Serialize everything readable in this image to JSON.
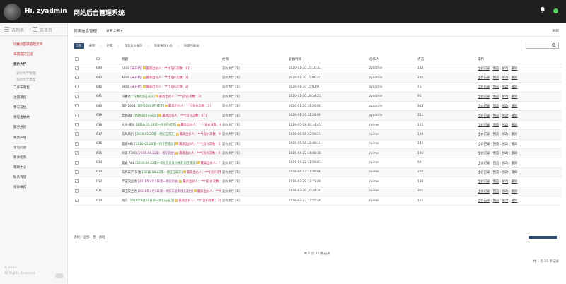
{
  "header": {
    "greeting": "Hi, zyadmin",
    "system_title": "网站后台管理系统"
  },
  "sidebar": {
    "tabs": [
      "选列表",
      "选单页"
    ],
    "items": [
      {
        "label": "切换到首级管理菜单",
        "cls": "hi"
      },
      {
        "label": "车辆成交记录",
        "cls": "hi"
      },
      {
        "label": "竞价大厅",
        "cls": "active"
      },
      {
        "label": "竞价大厅管理",
        "cls": "sub"
      },
      {
        "label": "竞价大厅类型",
        "cls": "sub"
      },
      {
        "label": "二手车寄售",
        "cls": ""
      },
      {
        "label": "注册流程",
        "cls": ""
      },
      {
        "label": "参与竞拍",
        "cls": ""
      },
      {
        "label": "保证金缴纳",
        "cls": ""
      },
      {
        "label": "服务条款",
        "cls": ""
      },
      {
        "label": "免责声明",
        "cls": ""
      },
      {
        "label": "常见问题",
        "cls": ""
      },
      {
        "label": "新手指南",
        "cls": ""
      },
      {
        "label": "帮助中心",
        "cls": ""
      },
      {
        "label": "联系我们",
        "cls": ""
      },
      {
        "label": "投诉举报",
        "cls": ""
      }
    ],
    "footer": [
      "© 2014",
      "All Rights Reserved."
    ]
  },
  "main": {
    "breadcrumb": "列表信息管理",
    "view_label": "查看全部",
    "refresh_label": "刷新",
    "filters": [
      "全部",
      "未审",
      "已审",
      "首页竞价推荐",
      "预发布的文档",
      "内容回收站"
    ],
    "columns": [
      "ID",
      "标题",
      "栏目",
      "竞拍时间",
      "发布人",
      "点击",
      "操作"
    ],
    "rows": [
      {
        "id": "644",
        "title": "5008",
        "status": "[未开始]",
        "done": false,
        "extra": "[竞价次数：11]",
        "cat": "竞价大厅 [1]",
        "date": "2020-01-30 15:10:31",
        "user": "zyadmin",
        "clicks": "132"
      },
      {
        "id": "643",
        "title": "4008",
        "status": "[未开始]",
        "done": false,
        "extra": "[竞价次数：2]",
        "cat": "竞价大厅 [1]",
        "date": "2020-01-30 15:09:47",
        "user": "zyadmin",
        "clicks": "295"
      },
      {
        "id": "642",
        "title": "3008",
        "status": "[未开始]",
        "done": false,
        "extra": "[竞价次数：2]",
        "cat": "竞价大厅 [1]",
        "date": "2020-01-30 15:03:07",
        "user": "zyadmin",
        "clicks": "71"
      },
      {
        "id": "641",
        "title": "马嘉达",
        "status": "[马嘉达][已成交]",
        "done": true,
        "extra": "[竞价次数：3]",
        "cat": "竞价大厅 [1]",
        "date": "2020-01-30 18:54:21",
        "user": "zyadmin",
        "clicks": "91"
      },
      {
        "id": "640",
        "title": "保时2008",
        "status": "[保时2008][已成交]",
        "done": true,
        "extra": "[竞价次数：3]",
        "cat": "竞价大厅 [1]",
        "date": "2020-01-30 21:26:00",
        "user": "zyadmin",
        "clicks": "313"
      },
      {
        "id": "639",
        "title": "奔驰s级",
        "status": "[奔驰s级][已成交]",
        "done": true,
        "extra": "[竞价次数：67]",
        "cat": "竞价大厅 [1]",
        "date": "2020-01-30 21:28:00",
        "user": "zyadmin",
        "clicks": "311"
      },
      {
        "id": "638",
        "title": "大众-捷达",
        "status": "[2016.05.20第一场][已成交]",
        "done": true,
        "extra": "[竞价次数：6]",
        "cat": "竞价大厅 [1]",
        "date": "2016-05-18 00:14:45",
        "user": "ruimei",
        "clicks": "165"
      },
      {
        "id": "637",
        "title": "东风风行",
        "status": "[2016.05.20第一场][已成交]",
        "done": true,
        "extra": "[竞价次数：9]",
        "cat": "竞价大厅 [1]",
        "date": "2016-05-16 23:59:21",
        "user": "ruimei",
        "clicks": "199"
      },
      {
        "id": "636",
        "title": "奥迪A6L",
        "status": "[2016.05.20第一场][已成交]",
        "done": true,
        "extra": "[竞价次数：23]",
        "cat": "竞价大厅 [1]",
        "date": "2016-05-16 12:49:15",
        "user": "ruimei",
        "clicks": "146"
      },
      {
        "id": "635",
        "title": "众泰-T300",
        "status": "[2016.04.22第一场][流拍]",
        "done": false,
        "extra": "[竞价次数：0]",
        "cat": "竞价大厅 [1]",
        "date": "2016-04-22 14:08:38",
        "user": "ruimei",
        "clicks": "146"
      },
      {
        "id": "634",
        "title": "奥迪 A6L",
        "status": "[2016.04.22第一场][首页竞价推荐][已成交]",
        "done": true,
        "extra": "[竞价次数：3]",
        "cat": "竞价大厅 [1]",
        "date": "2016-04-22 11:59:03",
        "user": "ruimei",
        "clicks": "69"
      },
      {
        "id": "633",
        "title": "东风日产-轩逸",
        "status": "[2016.04.22第一场][已成交]",
        "done": true,
        "extra": "[竞价次数：14]",
        "cat": "竞价大厅 [1]",
        "date": "2016-04-22 11:46:08",
        "user": "ruimei",
        "clicks": "200"
      },
      {
        "id": "632",
        "title": "丰田汉兰达",
        "status": "[2016年4月1日第一场][流拍]",
        "done": false,
        "extra": "[竞价次数：0]",
        "cat": "竞价大厅 [1]",
        "date": "2016-03-29 12:21:49",
        "user": "ruimei",
        "clicks": "134"
      },
      {
        "id": "631",
        "title": "丰田汉兰达",
        "status": "[2016年4月1日第一场][未设审核][流拍]",
        "done": false,
        "extra": "[竞价次数：7]",
        "cat": "竞价大厅 [1]",
        "date": "2016-03-29 10:44:26",
        "user": "ruimei",
        "clicks": "301"
      },
      {
        "id": "614",
        "title": "海马",
        "status": "[2016年3月26日第一场][已成交]",
        "done": true,
        "extra": "[竞价次数：2]",
        "cat": "竞价大厅 [1]",
        "date": "2016-03-23 12:55:40",
        "user": "ruimei",
        "clicks": "165"
      }
    ],
    "row_highlight_text": "最高出价人：***",
    "ops": [
      "出价记录",
      "预览",
      "修改",
      "删除"
    ],
    "bottom": {
      "select_label": "选择：",
      "links": [
        "全部",
        "无",
        "删除"
      ]
    },
    "pagination": "共 1 页 15 条记录"
  }
}
